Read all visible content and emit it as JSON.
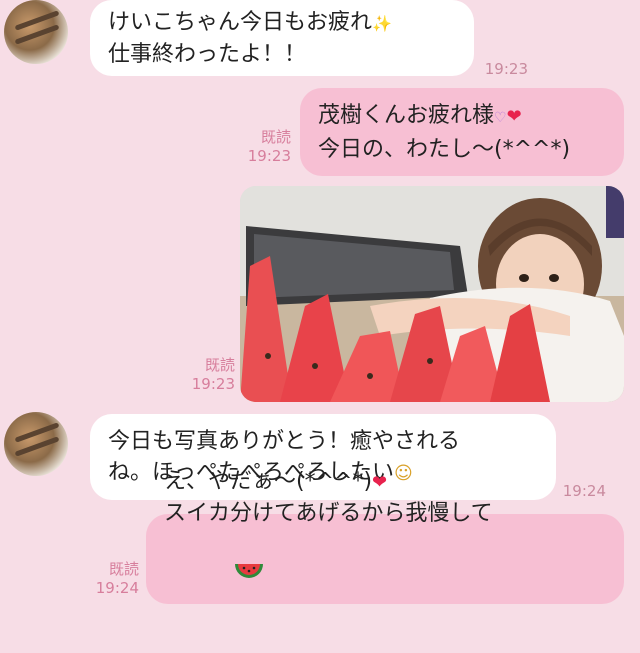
{
  "messages": [
    {
      "line1": "けいこちゃん今日もお疲れ",
      "line2": "仕事終わったよ！！",
      "time": "19:23"
    },
    {
      "line1": "茂樹くんお疲れ様",
      "line2": "今日の、わたし～(*^^*)",
      "read": "既読",
      "time": "19:23"
    },
    {
      "read": "既読",
      "time": "19:23"
    },
    {
      "line1": "今日も写真ありがとう！癒やされる",
      "line2": "ね。ほっぺたぺろぺろしたい",
      "time": "19:24"
    },
    {
      "line1": "え、やだぁ～(*^^*)",
      "line2": "スイカ分けてあげるから我慢して",
      "read": "既読",
      "time": "19:24"
    }
  ],
  "icons": [
    "sparkle-icon",
    "heart-eyes-icon",
    "heart-icon",
    "sweat-face-icon",
    "watermelon-icon"
  ],
  "colors": {
    "background": "#f7dde6",
    "incoming_bubble": "#ffffff",
    "outgoing_bubble": "#f7bfd3",
    "read_text": "#d77e9c"
  }
}
